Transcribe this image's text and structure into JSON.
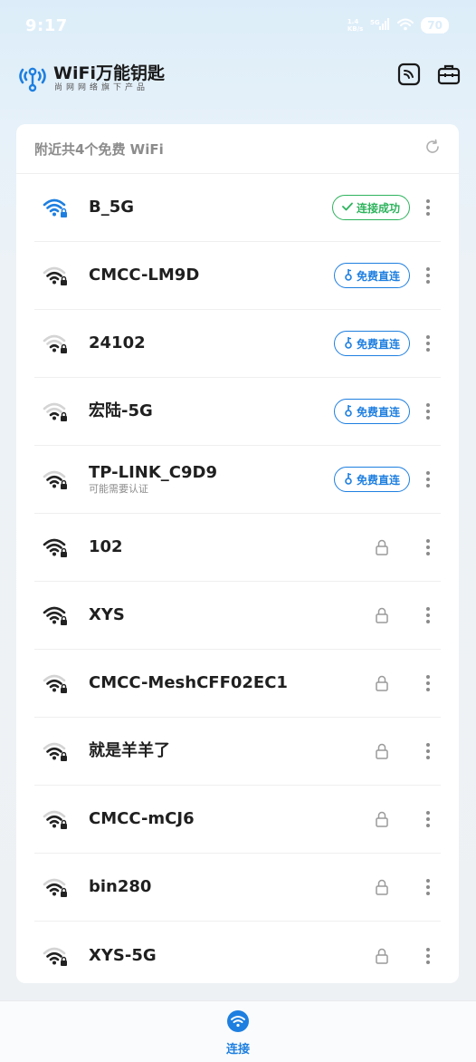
{
  "status_bar": {
    "time": "9:17",
    "net_type": "5G",
    "network_lines": [
      "1.4",
      "KB/s"
    ],
    "battery": "70"
  },
  "header": {
    "app_title": "WiFi万能钥匙",
    "app_subtitle": "尚网网络旗下产品",
    "logo_icon": "wifi-key-logo-icon",
    "actions": [
      {
        "name": "card-icon"
      },
      {
        "name": "toolbox-icon"
      }
    ]
  },
  "list_card": {
    "title": "附近共4个免费 WiFi",
    "refresh_icon": "refresh-icon",
    "networks": [
      {
        "name": "B_5G",
        "note": "",
        "signal": 4,
        "active": true,
        "status": "connected",
        "status_label": "连接成功"
      },
      {
        "name": "CMCC-LM9D",
        "note": "",
        "signal": 3,
        "active": false,
        "status": "free",
        "status_label": "免费直连"
      },
      {
        "name": "24102",
        "note": "",
        "signal": 2,
        "active": false,
        "status": "free",
        "status_label": "免费直连"
      },
      {
        "name": "宏陆-5G",
        "note": "",
        "signal": 2,
        "active": false,
        "status": "free",
        "status_label": "免费直连"
      },
      {
        "name": "TP-LINK_C9D9",
        "note": "可能需要认证",
        "signal": 3,
        "active": false,
        "status": "free",
        "status_label": "免费直连"
      },
      {
        "name": "102",
        "note": "",
        "signal": 4,
        "active": false,
        "status": "locked",
        "status_label": ""
      },
      {
        "name": "XYS",
        "note": "",
        "signal": 4,
        "active": false,
        "status": "locked",
        "status_label": ""
      },
      {
        "name": "CMCC-MeshCFF02EC1",
        "note": "",
        "signal": 3,
        "active": false,
        "status": "locked",
        "status_label": ""
      },
      {
        "name": "就是羊羊了",
        "note": "",
        "signal": 3,
        "active": false,
        "status": "locked",
        "status_label": ""
      },
      {
        "name": "CMCC-mCJ6",
        "note": "",
        "signal": 3,
        "active": false,
        "status": "locked",
        "status_label": ""
      },
      {
        "name": "bin280",
        "note": "",
        "signal": 3,
        "active": false,
        "status": "locked",
        "status_label": ""
      },
      {
        "name": "XYS-5G",
        "note": "",
        "signal": 3,
        "active": false,
        "status": "locked",
        "status_label": ""
      }
    ]
  },
  "bottom_nav": {
    "tabs": [
      {
        "label": "连接",
        "icon": "wifi-tab-icon",
        "active": true
      }
    ]
  },
  "colors": {
    "brand_blue": "#1e7fe0",
    "success_green": "#2eb35d",
    "text_dark": "#1f1f1f",
    "text_grey": "#8c8c8c"
  }
}
